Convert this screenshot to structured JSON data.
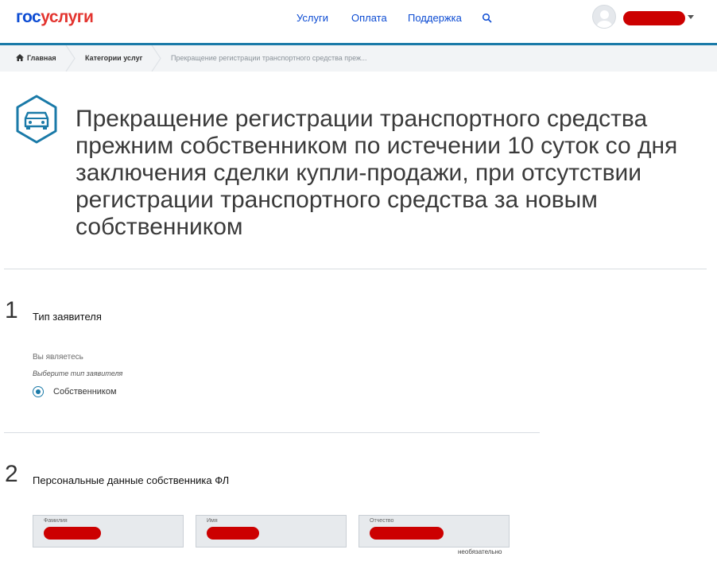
{
  "header": {
    "logo_part1": "гос",
    "logo_part2": "услуги",
    "nav": {
      "services": "Услуги",
      "payment": "Оплата",
      "support": "Поддержка"
    },
    "icons": [
      "search-icon",
      "user-avatar",
      "caret-down-icon"
    ]
  },
  "breadcrumb": {
    "home": "Главная",
    "category": "Категории услуг",
    "current": "Прекращение регистрации транспортного средства преж..."
  },
  "service": {
    "icon": "car-icon",
    "title": "Прекращение регистрации транспортного средства прежним собственником по истечении 10 суток со дня заключения сделки купли-продажи, при отсутствии регистрации транспортного средства за новым собственником"
  },
  "step1": {
    "number": "1",
    "title": "Тип заявителя",
    "label": "Вы являетесь",
    "hint": "Выберите тип заявителя",
    "option": "Собственником",
    "option_selected": true
  },
  "step2": {
    "number": "2",
    "title": "Персональные данные собственника ФЛ",
    "fields": {
      "last_name": "Фамилия",
      "first_name": "Имя",
      "middle_name": "Отчество"
    },
    "optional_note": "необязательно"
  },
  "colors": {
    "brand_blue": "#0d4cd3",
    "brand_red": "#e3342f",
    "accent": "#1a7aa8",
    "redaction": "#cc0000"
  }
}
